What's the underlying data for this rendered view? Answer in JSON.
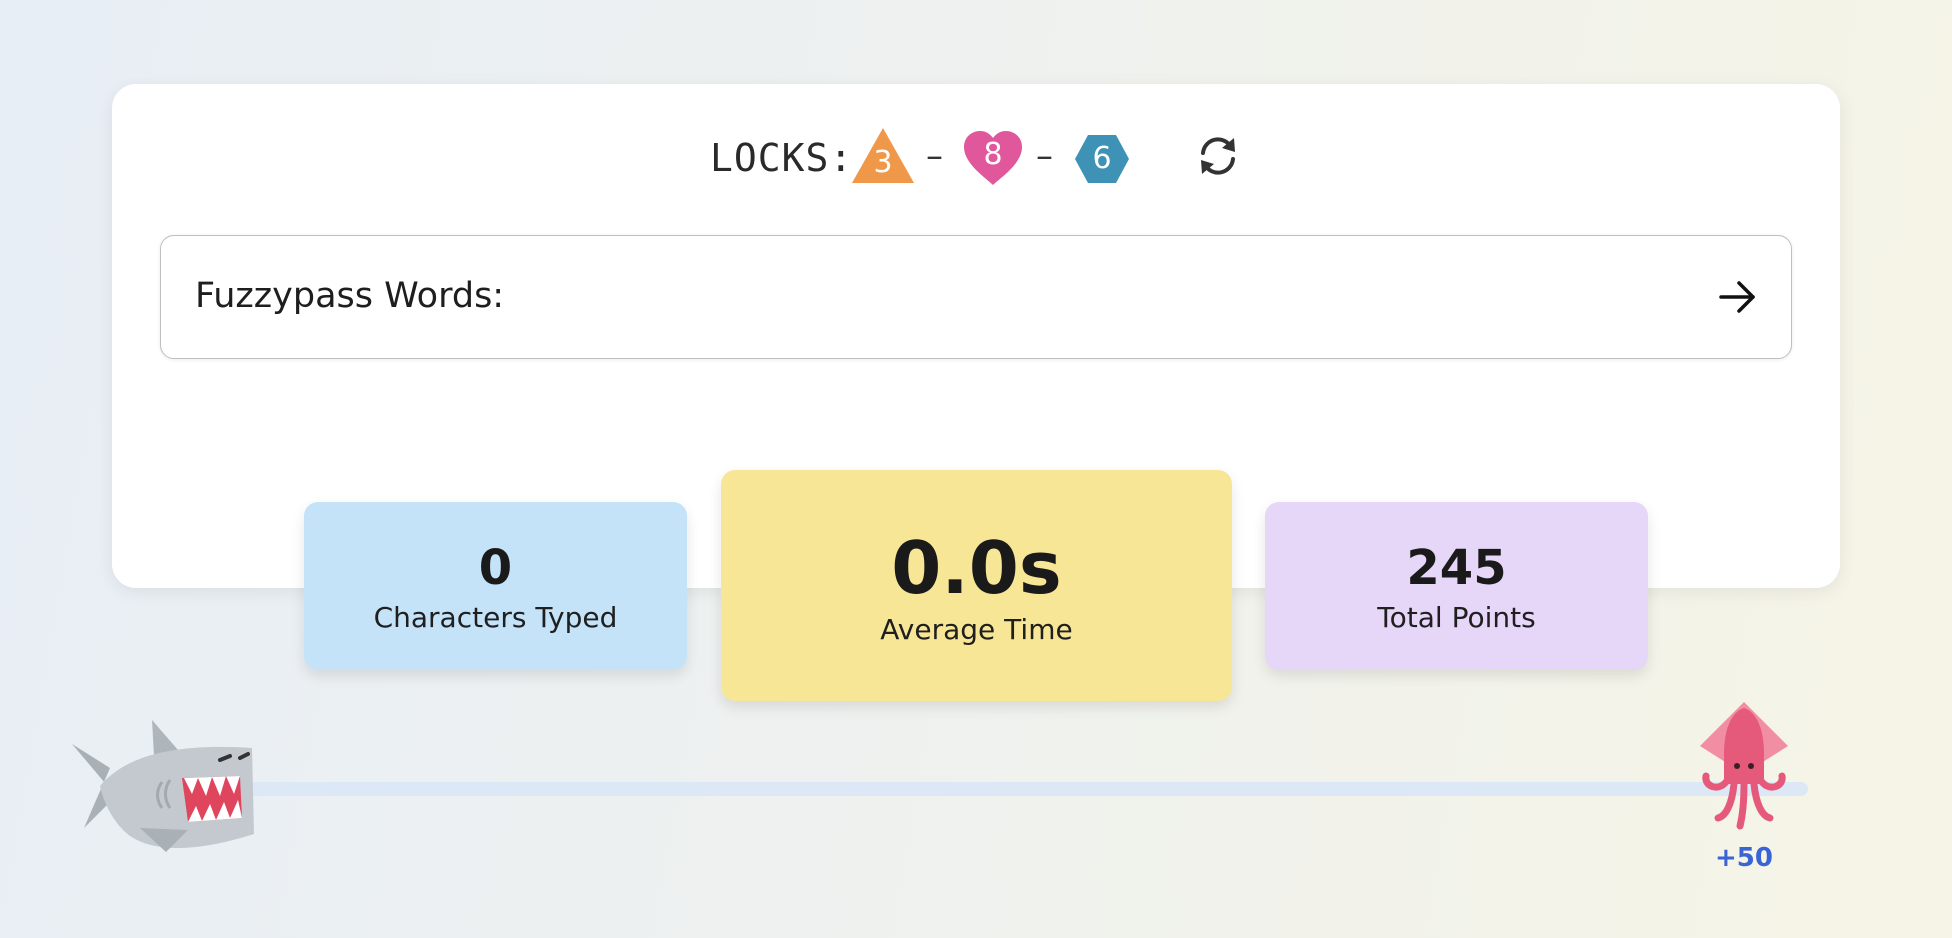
{
  "locks": {
    "label": "LOCKS:",
    "items": [
      {
        "shape": "triangle",
        "value": "3",
        "color": "#f0984a"
      },
      {
        "shape": "heart",
        "value": "8",
        "color": "#e0579b"
      },
      {
        "shape": "hexagon",
        "value": "6",
        "color": "#3e92b5"
      }
    ],
    "separator": "–",
    "refresh_icon": "refresh-icon"
  },
  "input": {
    "label": "Fuzzypass Words:",
    "value": "",
    "submit_icon": "arrow-right-icon"
  },
  "stats": [
    {
      "value": "0",
      "label": "Characters Typed",
      "color": "#c4e3f9"
    },
    {
      "value": "0.0s",
      "label": "Average Time",
      "color": "#f8e697"
    },
    {
      "value": "245",
      "label": "Total Points",
      "color": "#e6d6f8"
    }
  ],
  "race": {
    "chaser_icon": "shark-icon",
    "target_icon": "squid-icon",
    "bonus": "+50",
    "bonus_color": "#3a63d6"
  }
}
